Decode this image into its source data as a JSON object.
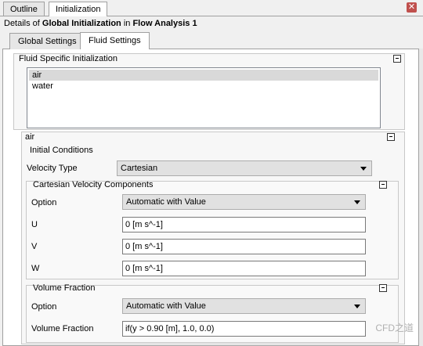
{
  "top_tabs": [
    "Outline",
    "Initialization"
  ],
  "details": {
    "prefix": "Details of",
    "object": "Global Initialization",
    "mid": "in",
    "container": "Flow Analysis 1"
  },
  "sub_tabs": [
    "Global Settings",
    "Fluid Settings"
  ],
  "fluid_specific": {
    "title": "Fluid Specific Initialization",
    "items": [
      {
        "label": "air",
        "selected": true
      },
      {
        "label": "water",
        "selected": false
      }
    ]
  },
  "air_section": {
    "title": "air",
    "initial_conditions": {
      "title": "Initial Conditions",
      "velocity_type_label": "Velocity Type",
      "velocity_type_value": "Cartesian"
    },
    "cartesian": {
      "title": "Cartesian Velocity Components",
      "option_label": "Option",
      "option_value": "Automatic with Value",
      "u_label": "U",
      "u_value": "0 [m s^-1]",
      "v_label": "V",
      "v_value": "0 [m s^-1]",
      "w_label": "W",
      "w_value": "0 [m s^-1]"
    },
    "volume_fraction": {
      "title": "Volume Fraction",
      "option_label": "Option",
      "option_value": "Automatic with Value",
      "vf_label": "Volume Fraction",
      "vf_value": "if(y > 0.90 [m], 1.0, 0.0)"
    }
  },
  "watermark": "CFD之道"
}
